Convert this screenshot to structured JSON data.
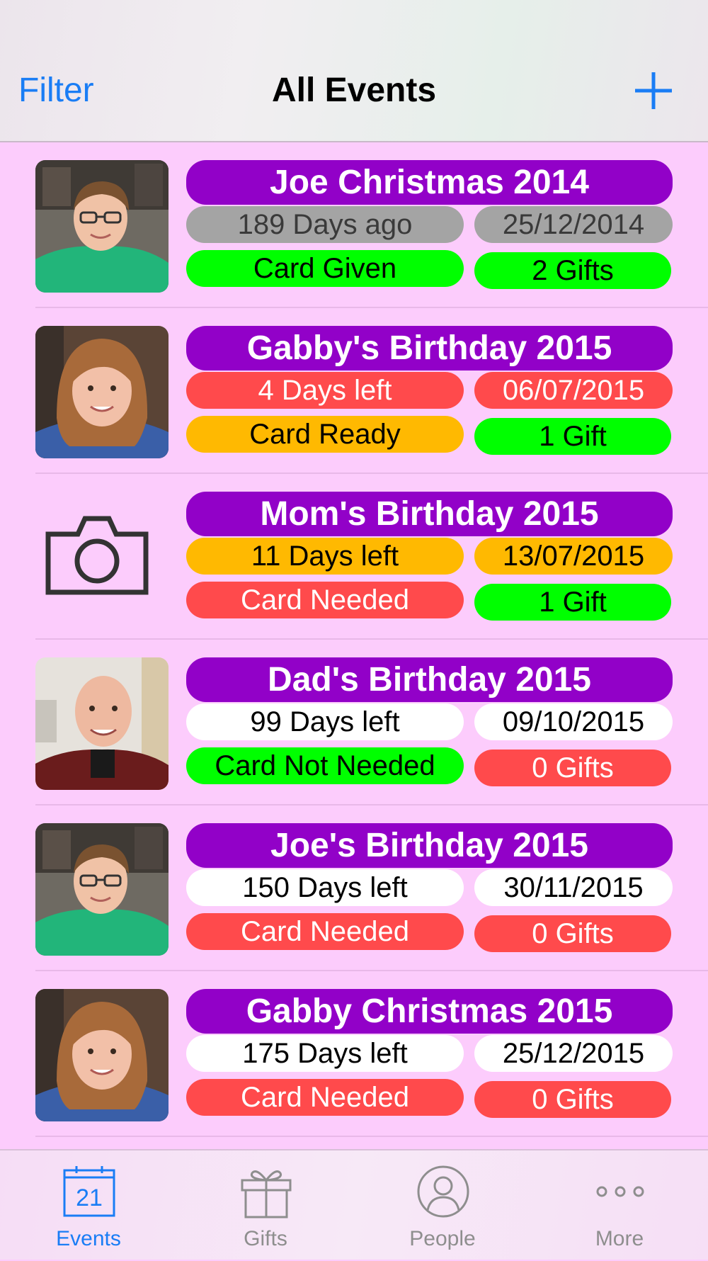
{
  "nav": {
    "filter_label": "Filter",
    "title": "All Events",
    "add_icon": "plus-icon"
  },
  "colors": {
    "background": "#fcccfc",
    "accent": "#1a7df5",
    "title_pill": "#9201c8",
    "grey": "#a4a4a4",
    "red": "#ff4a4c",
    "orange": "#ffb901",
    "green": "#00ff00",
    "white": "#ffffff"
  },
  "events": [
    {
      "title": "Joe Christmas 2014",
      "photo": "boy-photo",
      "days": {
        "text": "189 Days ago",
        "color": "grey"
      },
      "date": {
        "text": "25/12/2014",
        "color": "grey"
      },
      "card": {
        "text": "Card Given",
        "color": "green"
      },
      "gifts": {
        "text": "2 Gifts",
        "color": "green"
      }
    },
    {
      "title": "Gabby's Birthday 2015",
      "photo": "girl-photo",
      "days": {
        "text": "4 Days left",
        "color": "red"
      },
      "date": {
        "text": "06/07/2015",
        "color": "red"
      },
      "card": {
        "text": "Card Ready",
        "color": "orange"
      },
      "gifts": {
        "text": "1 Gift",
        "color": "green"
      }
    },
    {
      "title": "Mom's Birthday 2015",
      "photo": "camera-icon",
      "days": {
        "text": "11 Days left",
        "color": "orange"
      },
      "date": {
        "text": "13/07/2015",
        "color": "orange"
      },
      "card": {
        "text": "Card Needed",
        "color": "red"
      },
      "gifts": {
        "text": "1 Gift",
        "color": "green"
      }
    },
    {
      "title": "Dad's Birthday 2015",
      "photo": "man-photo",
      "days": {
        "text": "99 Days left",
        "color": "white"
      },
      "date": {
        "text": "09/10/2015",
        "color": "white"
      },
      "card": {
        "text": "Card Not Needed",
        "color": "green"
      },
      "gifts": {
        "text": "0 Gifts",
        "color": "red"
      }
    },
    {
      "title": "Joe's Birthday 2015",
      "photo": "boy-photo",
      "days": {
        "text": "150 Days left",
        "color": "white"
      },
      "date": {
        "text": "30/11/2015",
        "color": "white"
      },
      "card": {
        "text": "Card Needed",
        "color": "red"
      },
      "gifts": {
        "text": "0 Gifts",
        "color": "red"
      }
    },
    {
      "title": "Gabby Christmas 2015",
      "photo": "girl-photo",
      "days": {
        "text": "175 Days left",
        "color": "white"
      },
      "date": {
        "text": "25/12/2015",
        "color": "white"
      },
      "card": {
        "text": "Card Needed",
        "color": "red"
      },
      "gifts": {
        "text": "0 Gifts",
        "color": "red"
      }
    }
  ],
  "tabs": [
    {
      "label": "Events",
      "icon": "calendar-icon",
      "calendar_day": "21",
      "active": true
    },
    {
      "label": "Gifts",
      "icon": "gift-icon",
      "active": false
    },
    {
      "label": "People",
      "icon": "person-icon",
      "active": false
    },
    {
      "label": "More",
      "icon": "more-icon",
      "active": false
    }
  ]
}
